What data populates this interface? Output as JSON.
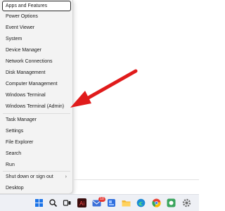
{
  "menu": {
    "items": [
      {
        "label": "Apps and Features",
        "focused": true
      },
      {
        "label": "Power Options"
      },
      {
        "label": "Event Viewer"
      },
      {
        "label": "System"
      },
      {
        "label": "Device Manager"
      },
      {
        "label": "Network Connections"
      },
      {
        "label": "Disk Management"
      },
      {
        "label": "Computer Management"
      },
      {
        "label": "Windows Terminal"
      },
      {
        "label": "Windows Terminal (Admin)"
      },
      {
        "label": "Task Manager"
      },
      {
        "label": "Settings"
      },
      {
        "label": "File Explorer"
      },
      {
        "label": "Search"
      },
      {
        "label": "Run"
      },
      {
        "label": "Shut down or sign out",
        "submenu_indicator": "›"
      },
      {
        "label": "Desktop"
      }
    ]
  },
  "taskbar": {
    "icons": [
      {
        "name": "start-icon",
        "color": "#1a73e8"
      },
      {
        "name": "search-icon",
        "color": "#202020"
      },
      {
        "name": "task-view-icon",
        "color": "#202020"
      },
      {
        "name": "adobe-icon",
        "color": "#d32f2f"
      },
      {
        "name": "mail-icon",
        "color": "#3a6fd8",
        "badge": "10"
      },
      {
        "name": "widgets-icon",
        "color": "#2f6fde"
      },
      {
        "name": "file-explorer-icon",
        "color": "#f2b632"
      },
      {
        "name": "edge-icon",
        "color": "#1c8ad6"
      },
      {
        "name": "chrome-icon",
        "color": "#e94235"
      },
      {
        "name": "app-icon-green",
        "color": "#3aa55d"
      },
      {
        "name": "settings-icon",
        "color": "#6f6f6f"
      }
    ]
  },
  "annotation": {
    "arrow_color": "#e01b1b"
  }
}
